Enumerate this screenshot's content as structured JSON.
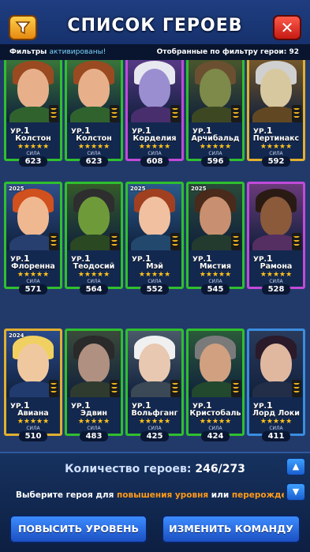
{
  "header": {
    "title": "СПИСОК ГЕРОЕВ",
    "filter_icon": "funnel-icon",
    "close_icon": "close-icon",
    "close_glyph": "✕"
  },
  "status": {
    "filters_word": "Фильтры",
    "filters_state": "активированы!",
    "filtered_count_label": "Отобранные по фильтру герои: 92"
  },
  "level_prefix": "УР.",
  "power_label": "СИЛА",
  "stars_glyph": "★★★★★",
  "heroes": [
    {
      "name": "Колстон",
      "level": "1",
      "power": "623",
      "badge": "",
      "frame": "green"
    },
    {
      "name": "Колстон",
      "level": "1",
      "power": "623",
      "badge": "",
      "frame": "green"
    },
    {
      "name": "Корделия",
      "level": "1",
      "power": "608",
      "badge": "",
      "frame": "purple"
    },
    {
      "name": "Арчибальд",
      "level": "1",
      "power": "596",
      "badge": "",
      "frame": "green"
    },
    {
      "name": "Пертинакс",
      "level": "1",
      "power": "592",
      "badge": "",
      "frame": "gold"
    },
    {
      "name": "Флоренна",
      "level": "1",
      "power": "571",
      "badge": "2025",
      "frame": "green"
    },
    {
      "name": "Теодосий",
      "level": "1",
      "power": "564",
      "badge": "",
      "frame": "green"
    },
    {
      "name": "Мэй",
      "level": "1",
      "power": "552",
      "badge": "2025",
      "frame": "green"
    },
    {
      "name": "Мистия",
      "level": "1",
      "power": "545",
      "badge": "2025",
      "frame": "green"
    },
    {
      "name": "Рамона",
      "level": "1",
      "power": "528",
      "badge": "",
      "frame": "purple"
    },
    {
      "name": "Авиана",
      "level": "1",
      "power": "510",
      "badge": "2024",
      "frame": "gold"
    },
    {
      "name": "Эдвин",
      "level": "1",
      "power": "483",
      "badge": "",
      "frame": "green"
    },
    {
      "name": "Вольфганг",
      "level": "1",
      "power": "425",
      "badge": "",
      "frame": "green"
    },
    {
      "name": "Кристобаль",
      "level": "1",
      "power": "424",
      "badge": "",
      "frame": "green"
    },
    {
      "name": "Лорд Локи",
      "level": "1",
      "power": "411",
      "badge": "",
      "frame": "blue"
    }
  ],
  "footer": {
    "count_label": "Количество героев:",
    "count_value": "246/273",
    "hint_prefix": "Выберите героя для ",
    "hint_level": "повышения уровня",
    "hint_or": " или ",
    "hint_rebirth": "перерождени",
    "level_up_button": "ПОВЫСИТЬ УРОВЕНЬ",
    "change_team_button": "ИЗМЕНИТЬ КОМАНДУ",
    "scroll_up_glyph": "▲",
    "scroll_down_glyph": "▼"
  }
}
